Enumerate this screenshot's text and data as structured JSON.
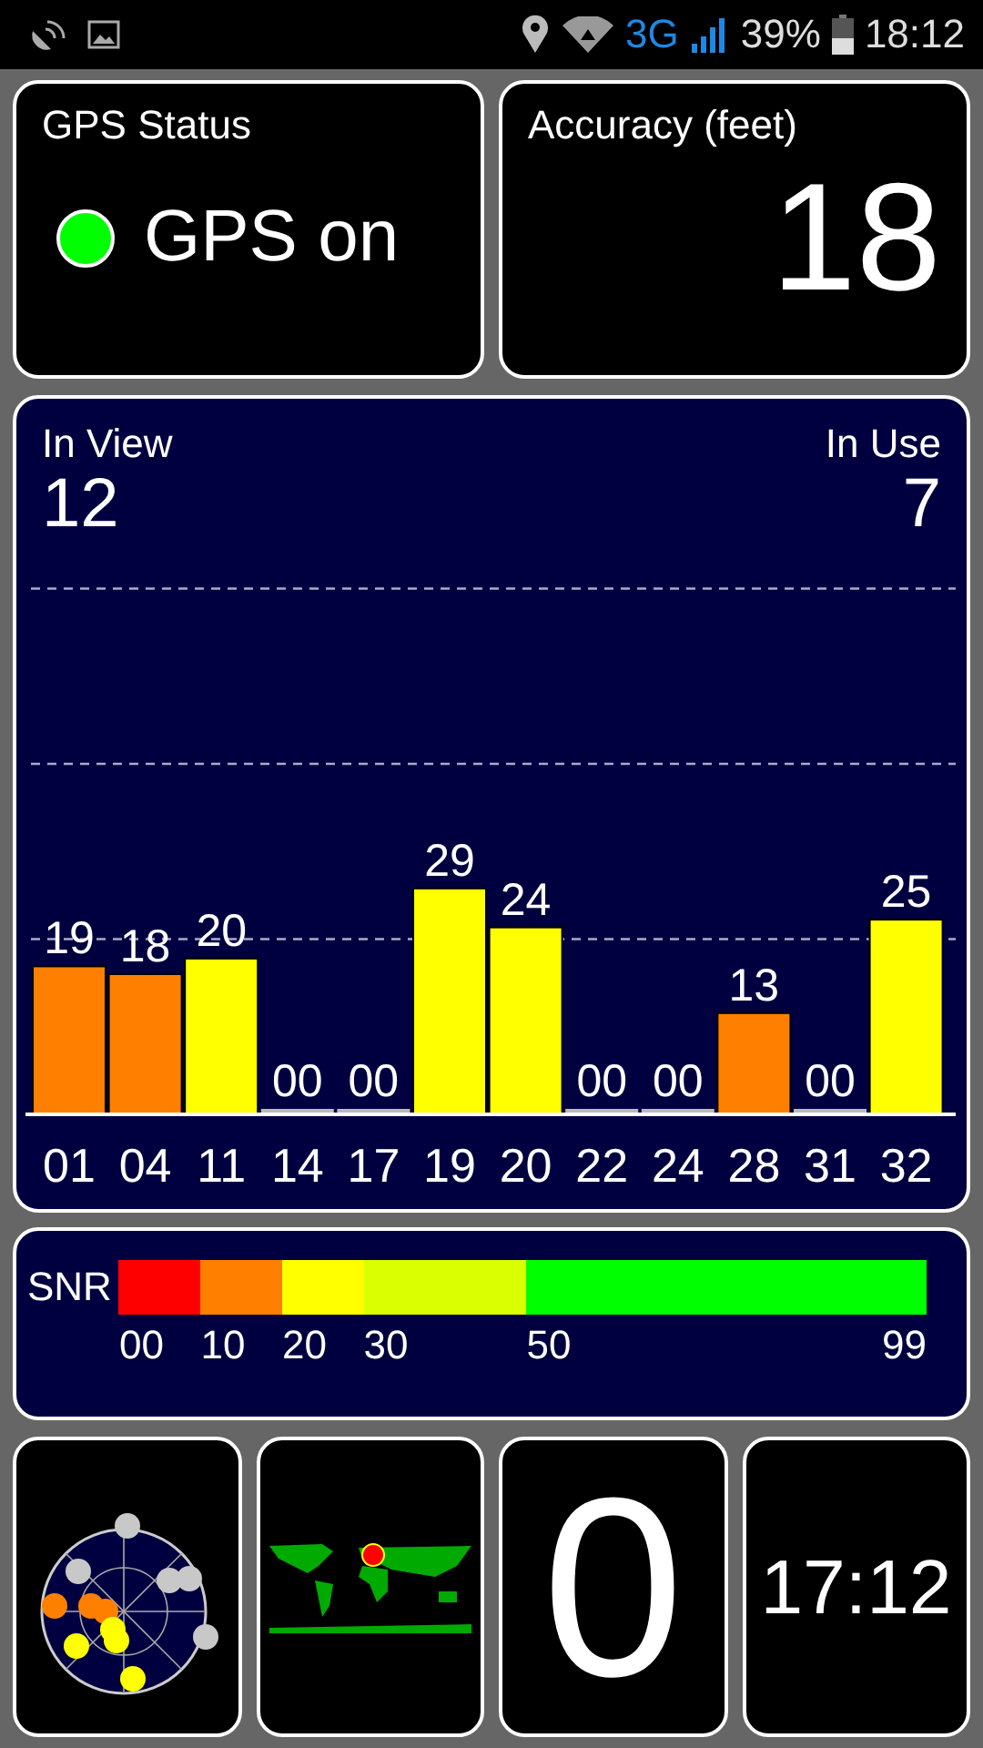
{
  "status_bar": {
    "network": "3G",
    "battery": "39%",
    "time": "18:12"
  },
  "gps_status": {
    "title": "GPS Status",
    "status": "GPS on",
    "on": true
  },
  "accuracy": {
    "title": "Accuracy (feet)",
    "value": "18"
  },
  "satellites": {
    "in_view_label": "In View",
    "in_view": "12",
    "in_use_label": "In Use",
    "in_use": "7",
    "chart_data": {
      "type": "bar",
      "categories": [
        "01",
        "04",
        "11",
        "14",
        "17",
        "19",
        "20",
        "22",
        "24",
        "28",
        "31",
        "32"
      ],
      "values": [
        19,
        18,
        20,
        0,
        0,
        29,
        24,
        0,
        0,
        13,
        0,
        25
      ],
      "value_labels": [
        "19",
        "18",
        "20",
        "00",
        "00",
        "29",
        "24",
        "00",
        "00",
        "13",
        "00",
        "25"
      ]
    }
  },
  "snr_legend": {
    "label": "SNR",
    "segments": [
      {
        "color": "#ff0000"
      },
      {
        "color": "#ff8000"
      },
      {
        "color": "#ffff00"
      },
      {
        "color": "#d9ff00"
      },
      {
        "color": "#00ff00"
      }
    ],
    "ticks": [
      "00",
      "10",
      "20",
      "30",
      "50",
      "99"
    ]
  },
  "counter": {
    "value": "0"
  },
  "clock": {
    "time": "17:12"
  }
}
